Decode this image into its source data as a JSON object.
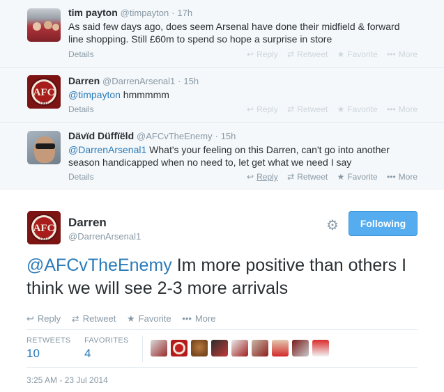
{
  "conversation": [
    {
      "fullname": "tim payton",
      "handle": "@timpayton",
      "time": "17h",
      "text": "As said few days ago, does seem Arsenal have done their midfield & forward line shopping. Still £60m to spend so hope a surprise in store"
    },
    {
      "fullname": "Darren",
      "handle": "@DarrenArsenal1",
      "time": "15h",
      "text_link": "@timpayton",
      "text_rest": " hmmmmm"
    },
    {
      "fullname": "Dävïd Düffïëld",
      "handle": "@AFCvTheEnemy",
      "time": "15h",
      "text_link": "@DarrenArsenal1",
      "text_rest": "  What's your feeling on this Darren, can't go into another season handicapped when no need to, let get what we need I say"
    }
  ],
  "labels": {
    "details": "Details",
    "reply": "Reply",
    "retweet": "Retweet",
    "favorite": "Favorite",
    "more": "More",
    "separator": "·"
  },
  "main_tweet": {
    "fullname": "Darren",
    "handle": "@DarrenArsenal1",
    "follow_label": "Following",
    "text_link": "@AFCvTheEnemy",
    "text_rest": " Im more positive than others I think we will see 2-3 more arrivals",
    "stats": {
      "retweets_label": "RETWEETS",
      "retweets_value": "10",
      "favorites_label": "FAVORITES",
      "favorites_value": "4"
    },
    "timestamp": "3:25 AM - 23 Jul 2014"
  },
  "crest_text": {
    "letters": "AFC",
    "year": "1932"
  },
  "icons": {
    "reply": "reply-icon",
    "retweet": "retweet-icon",
    "favorite": "star-icon",
    "more": "more-dots-icon",
    "gear": "gear-icon"
  },
  "colors": {
    "link": "#2b7bb9",
    "follow_button": "#55acee",
    "conversation_bg": "#f5f8fa",
    "muted": "#8899a6"
  },
  "favoriter_count_shown": 9
}
